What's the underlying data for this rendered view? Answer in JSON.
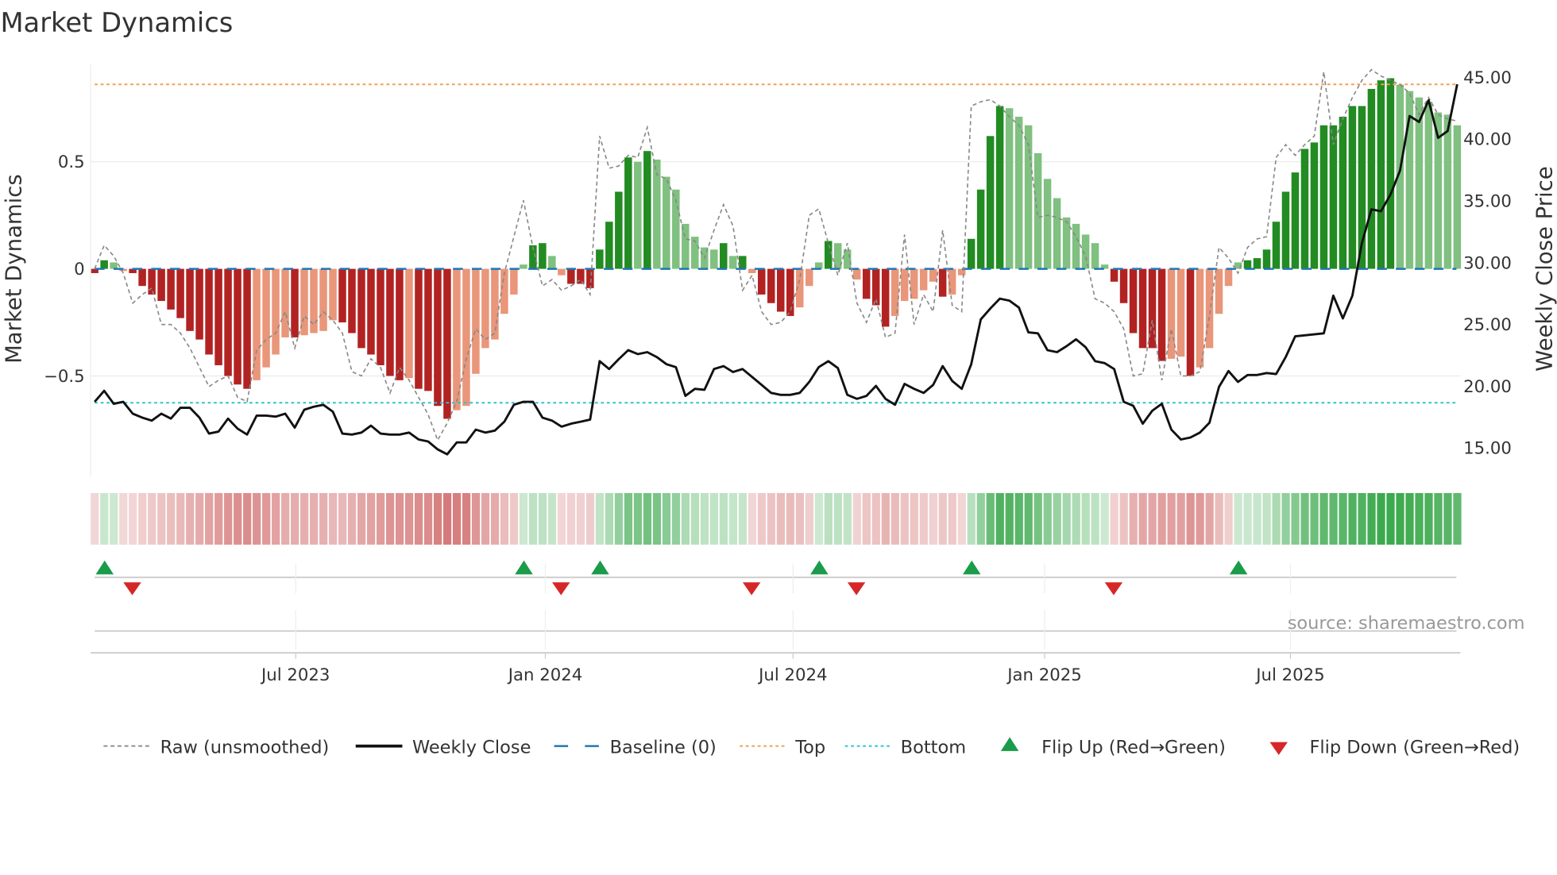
{
  "title": "Market Dynamics",
  "source": "source: sharemaestro.com",
  "colors": {
    "green_dark": "#228b22",
    "green_light": "#80c080",
    "red_dark": "#b22222",
    "red_light": "#e9967a",
    "raw": "#888888",
    "close": "#111111",
    "baseline": "#1f77b4",
    "top": "#f0a050",
    "bottom": "#2ec4d0",
    "flip_up": "#1a9c4a",
    "flip_down": "#d62728",
    "strip_green": "40,160,60",
    "strip_red": "200,80,80"
  },
  "chart_data": {
    "type": "bar",
    "title": "Market Dynamics",
    "ylabel": "Market Dynamics",
    "y2label": "Weekly Close Price",
    "start_week": "2023-02-03",
    "frequency": "weekly",
    "ylim": [
      -0.968,
      0.954
    ],
    "y2lim": [
      12.72,
      46.04
    ],
    "yticks": [
      {
        "v": 0.5,
        "label": "0.5"
      },
      {
        "v": 0,
        "label": "0"
      },
      {
        "v": -0.5,
        "label": "−0.5"
      }
    ],
    "y2ticks": [
      {
        "v": 45,
        "label": "45.00"
      },
      {
        "v": 40,
        "label": "40.00"
      },
      {
        "v": 35,
        "label": "35.00"
      },
      {
        "v": 30,
        "label": "30.00"
      },
      {
        "v": 25,
        "label": "25.00"
      },
      {
        "v": 20,
        "label": "20.00"
      },
      {
        "v": 15,
        "label": "15.00"
      }
    ],
    "xticks": [
      {
        "week": 21.1,
        "label": "Jul 2023"
      },
      {
        "week": 47.3,
        "label": "Jan 2024"
      },
      {
        "week": 73.3,
        "label": "Jul 2024"
      },
      {
        "week": 99.7,
        "label": "Jan 2025"
      },
      {
        "week": 125.5,
        "label": "Jul 2025"
      }
    ],
    "top_level": 0.861,
    "bottom_level": -0.625,
    "baseline": 0,
    "smoothed": [
      -0.02,
      0.04,
      0.03,
      -0.01,
      -0.02,
      -0.08,
      -0.12,
      -0.15,
      -0.19,
      -0.23,
      -0.29,
      -0.33,
      -0.4,
      -0.45,
      -0.5,
      -0.54,
      -0.56,
      -0.52,
      -0.46,
      -0.4,
      -0.32,
      -0.32,
      -0.31,
      -0.3,
      -0.29,
      -0.24,
      -0.25,
      -0.3,
      -0.37,
      -0.4,
      -0.45,
      -0.5,
      -0.52,
      -0.51,
      -0.56,
      -0.57,
      -0.64,
      -0.7,
      -0.66,
      -0.64,
      -0.49,
      -0.37,
      -0.33,
      -0.21,
      -0.12,
      0.02,
      0.11,
      0.12,
      0.06,
      -0.03,
      -0.07,
      -0.07,
      -0.09,
      0.09,
      0.22,
      0.36,
      0.52,
      0.5,
      0.55,
      0.51,
      0.43,
      0.37,
      0.21,
      0.15,
      0.1,
      0.09,
      0.12,
      0.06,
      0.06,
      -0.02,
      -0.12,
      -0.16,
      -0.2,
      -0.22,
      -0.18,
      -0.08,
      0.03,
      0.13,
      0.12,
      0.09,
      -0.05,
      -0.14,
      -0.17,
      -0.27,
      -0.22,
      -0.15,
      -0.14,
      -0.1,
      -0.06,
      -0.13,
      -0.12,
      -0.03,
      0.14,
      0.37,
      0.62,
      0.76,
      0.75,
      0.71,
      0.67,
      0.54,
      0.42,
      0.33,
      0.24,
      0.21,
      0.16,
      0.12,
      0.02,
      -0.06,
      -0.16,
      -0.3,
      -0.37,
      -0.37,
      -0.43,
      -0.42,
      -0.41,
      -0.5,
      -0.46,
      -0.37,
      -0.21,
      -0.08,
      0.03,
      0.04,
      0.05,
      0.09,
      0.22,
      0.36,
      0.45,
      0.56,
      0.59,
      0.67,
      0.67,
      0.71,
      0.76,
      0.76,
      0.84,
      0.88,
      0.89,
      0.86,
      0.83,
      0.8,
      0.78,
      0.73,
      0.72,
      0.67
    ],
    "raw": [
      0.0,
      0.11,
      0.06,
      -0.02,
      -0.16,
      -0.12,
      -0.09,
      -0.26,
      -0.26,
      -0.3,
      -0.37,
      -0.46,
      -0.55,
      -0.52,
      -0.5,
      -0.6,
      -0.62,
      -0.38,
      -0.33,
      -0.3,
      -0.2,
      -0.37,
      -0.22,
      -0.26,
      -0.2,
      -0.24,
      -0.3,
      -0.48,
      -0.5,
      -0.42,
      -0.46,
      -0.58,
      -0.46,
      -0.52,
      -0.6,
      -0.68,
      -0.8,
      -0.72,
      -0.62,
      -0.42,
      -0.28,
      -0.33,
      -0.3,
      -0.02,
      0.15,
      0.32,
      0.1,
      -0.08,
      -0.05,
      -0.1,
      -0.08,
      -0.05,
      -0.12,
      0.62,
      0.47,
      0.48,
      0.53,
      0.52,
      0.66,
      0.44,
      0.42,
      0.32,
      0.14,
      0.13,
      0.05,
      0.18,
      0.3,
      0.2,
      -0.1,
      -0.03,
      -0.2,
      -0.26,
      -0.25,
      -0.2,
      -0.05,
      0.25,
      0.28,
      0.12,
      -0.03,
      0.12,
      -0.16,
      -0.25,
      -0.14,
      -0.32,
      -0.3,
      0.16,
      -0.26,
      -0.12,
      -0.2,
      0.18,
      -0.17,
      -0.2,
      0.76,
      0.78,
      0.79,
      0.76,
      0.71,
      0.67,
      0.58,
      0.24,
      0.25,
      0.24,
      0.22,
      0.15,
      0.06,
      -0.14,
      -0.16,
      -0.2,
      -0.28,
      -0.5,
      -0.49,
      -0.24,
      -0.52,
      -0.28,
      -0.5,
      -0.5,
      -0.48,
      -0.22,
      0.1,
      0.05,
      -0.02,
      0.1,
      0.14,
      0.15,
      0.52,
      0.58,
      0.53,
      0.58,
      0.62,
      0.92,
      0.58,
      0.7,
      0.8,
      0.88,
      0.93,
      0.9,
      0.88,
      0.86,
      0.82,
      0.72,
      0.8,
      0.72,
      0.7,
      0.69
    ],
    "close": [
      18.74,
      19.63,
      18.58,
      18.74,
      17.78,
      17.46,
      17.22,
      17.78,
      17.38,
      18.26,
      18.26,
      17.46,
      16.17,
      16.33,
      17.38,
      16.57,
      16.09,
      17.62,
      17.62,
      17.54,
      17.78,
      16.65,
      18.1,
      18.34,
      18.5,
      17.94,
      16.17,
      16.09,
      16.25,
      16.81,
      16.17,
      16.09,
      16.09,
      16.25,
      15.69,
      15.53,
      14.89,
      14.49,
      15.45,
      15.45,
      16.49,
      16.25,
      16.41,
      17.13,
      18.5,
      18.74,
      18.74,
      17.46,
      17.22,
      16.73,
      16.97,
      17.13,
      17.3,
      22.03,
      21.39,
      22.19,
      22.92,
      22.6,
      22.76,
      22.36,
      21.79,
      21.55,
      19.22,
      19.79,
      19.71,
      21.39,
      21.63,
      21.15,
      21.39,
      20.75,
      20.11,
      19.46,
      19.3,
      19.3,
      19.46,
      20.35,
      21.55,
      22.03,
      21.47,
      19.3,
      18.98,
      19.22,
      20.03,
      18.98,
      18.5,
      20.19,
      19.79,
      19.46,
      20.11,
      21.63,
      20.43,
      19.79,
      21.79,
      25.41,
      26.29,
      27.09,
      26.93,
      26.37,
      24.36,
      24.28,
      22.92,
      22.76,
      23.24,
      23.8,
      23.16,
      22.03,
      21.87,
      21.39,
      18.74,
      18.42,
      16.97,
      18.02,
      18.58,
      16.49,
      15.69,
      15.85,
      16.25,
      17.05,
      19.95,
      21.23,
      20.35,
      20.91,
      20.91,
      21.07,
      20.99,
      22.36,
      24.04,
      24.12,
      24.2,
      24.28,
      27.33,
      25.49,
      27.33,
      31.59,
      34.32,
      34.16,
      35.52,
      37.45,
      41.87,
      41.39,
      43.15,
      40.1,
      40.66,
      44.44
    ],
    "flip_up_weeks": [
      1,
      45,
      53,
      76,
      92,
      120
    ],
    "flip_down_weeks": [
      4,
      49,
      69,
      80,
      107
    ],
    "legend": {
      "placement": "bottom",
      "items": [
        {
          "label": "Raw (unsmoothed)",
          "kind": "raw"
        },
        {
          "label": "Weekly Close",
          "kind": "close"
        },
        {
          "label": "Baseline (0)",
          "kind": "baseline"
        },
        {
          "label": "Top",
          "kind": "top"
        },
        {
          "label": "Bottom",
          "kind": "bottom"
        },
        {
          "label": "Flip Up (Red→Green)",
          "kind": "up"
        },
        {
          "label": "Flip Down (Green→Red)",
          "kind": "down"
        }
      ]
    }
  }
}
